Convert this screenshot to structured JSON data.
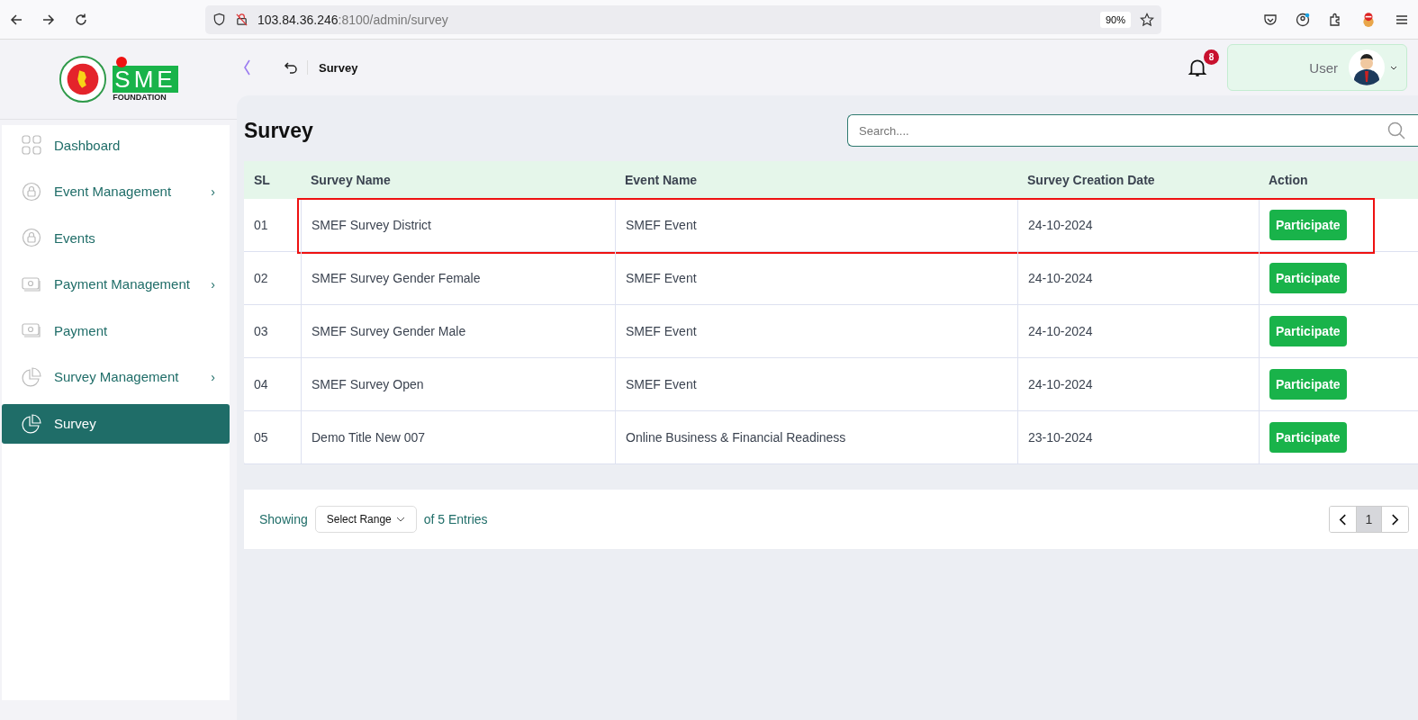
{
  "browser": {
    "url_host": "103.84.36.246",
    "url_path": ":8100/admin/survey",
    "zoom": "90%"
  },
  "logo": {
    "mark": "SME",
    "subtitle": "FOUNDATION"
  },
  "header": {
    "breadcrumb": "Survey",
    "notifications": "8",
    "user": "User"
  },
  "sidebar": {
    "items": [
      {
        "label": "Dashboard",
        "kind": "grid",
        "selected": false
      },
      {
        "label": "Event Management",
        "kind": "lock",
        "submenu_marker": "›",
        "selected": false
      },
      {
        "label": "Events",
        "kind": "lock",
        "selected": false
      },
      {
        "label": "Payment Management",
        "kind": "money",
        "submenu_marker": "›",
        "selected": false
      },
      {
        "label": "Payment",
        "kind": "money",
        "selected": false
      },
      {
        "label": "Survey Management",
        "kind": "pie",
        "submenu_marker": "›",
        "selected": false
      },
      {
        "label": "Survey",
        "kind": "pie",
        "selected": true
      }
    ]
  },
  "page": {
    "title": "Survey",
    "search_placeholder": "Search...."
  },
  "table": {
    "columns": [
      "SL",
      "Survey Name",
      "Event Name",
      "Survey Creation Date",
      "Action"
    ],
    "rows": [
      {
        "sl": "01",
        "survey": "SMEF Survey District",
        "event": "SMEF Event",
        "date": "24-10-2024",
        "action": "Participate",
        "highlighted": true
      },
      {
        "sl": "02",
        "survey": "SMEF Survey Gender Female",
        "event": "SMEF Event",
        "date": "24-10-2024",
        "action": "Participate",
        "highlighted": false
      },
      {
        "sl": "03",
        "survey": "SMEF Survey Gender Male",
        "event": "SMEF Event",
        "date": "24-10-2024",
        "action": "Participate",
        "highlighted": false
      },
      {
        "sl": "04",
        "survey": "SMEF Survey Open",
        "event": "SMEF Event",
        "date": "24-10-2024",
        "action": "Participate",
        "highlighted": false
      },
      {
        "sl": "05",
        "survey": "Demo Title New 007",
        "event": "Online Business & Financial Readiness",
        "date": "23-10-2024",
        "action": "Participate",
        "highlighted": false
      }
    ]
  },
  "footer": {
    "showing": "Showing",
    "range": "Select Range",
    "entries": "of 5 Entries",
    "pages": [
      {
        "label": "1",
        "selected": true
      }
    ]
  }
}
